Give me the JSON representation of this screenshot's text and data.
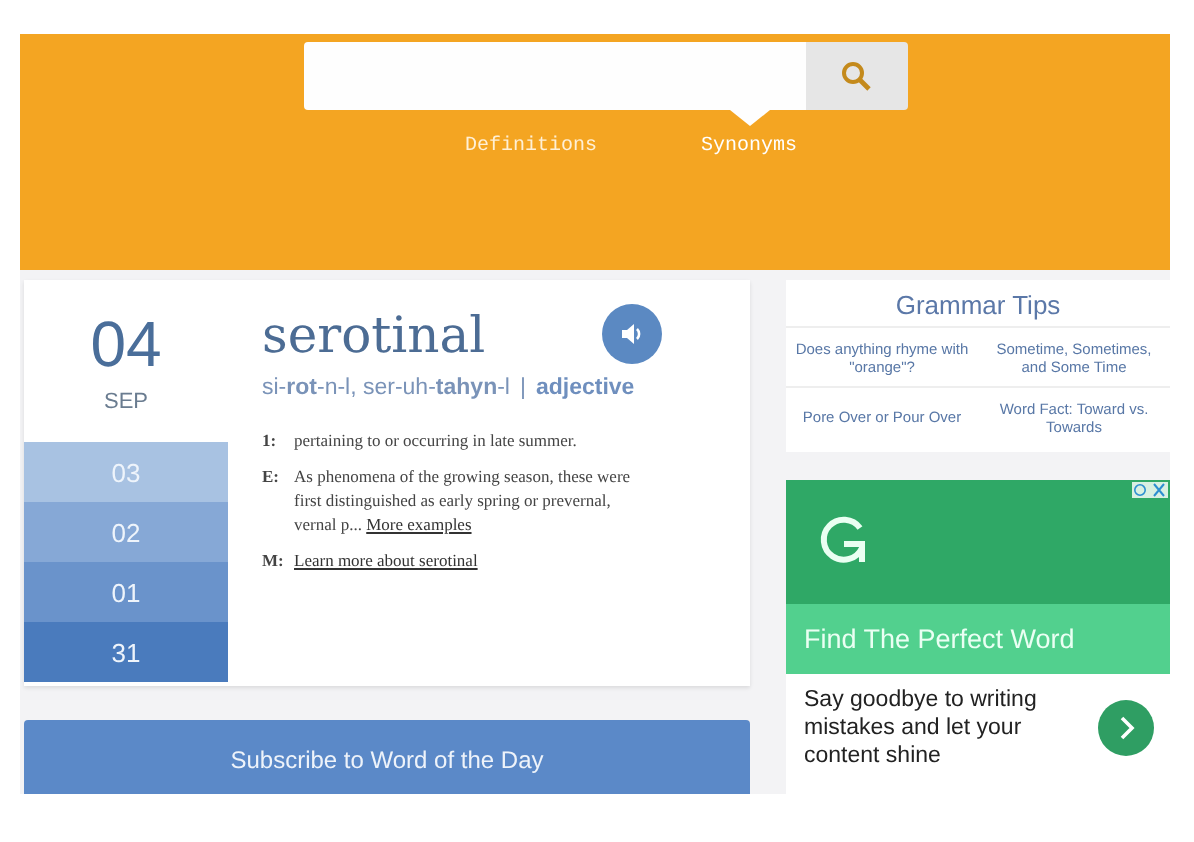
{
  "nav": [
    {
      "label": "Definitions",
      "selected": false
    },
    {
      "label": "Synonyms",
      "selected": true
    }
  ],
  "word_of_day": {
    "day": "04",
    "month": "SEP",
    "word": "serotinal",
    "pronunciation": "si-**rot**-n-l, ser-uh-**tahyn**-l",
    "separator": "|",
    "part_of_speech": "adjective",
    "previous_days": [
      "03",
      "02",
      "01",
      "31"
    ],
    "entries": [
      {
        "marker": "1:",
        "text": "pertaining to or occurring in late summer."
      },
      {
        "marker": "E:",
        "text": "As phenomena of the growing season, these were first distinguished as early spring or prevernal, vernal p...",
        "link": "More examples"
      },
      {
        "marker": "M:",
        "link": "Learn more about serotinal"
      }
    ]
  },
  "subscribe_button": "Subscribe to Word of the Day",
  "grammar_tips": {
    "title": "Grammar Tips",
    "items": [
      "Does anything rhyme with \"orange\"?",
      "Sometime, Sometimes, and Some Time",
      "Pore Over or Pour Over",
      "Word Fact: Toward vs. Towards"
    ]
  },
  "ad": {
    "headline": "Find The Perfect Word",
    "body": "Say goodbye to writing mistakes and let your content shine"
  }
}
